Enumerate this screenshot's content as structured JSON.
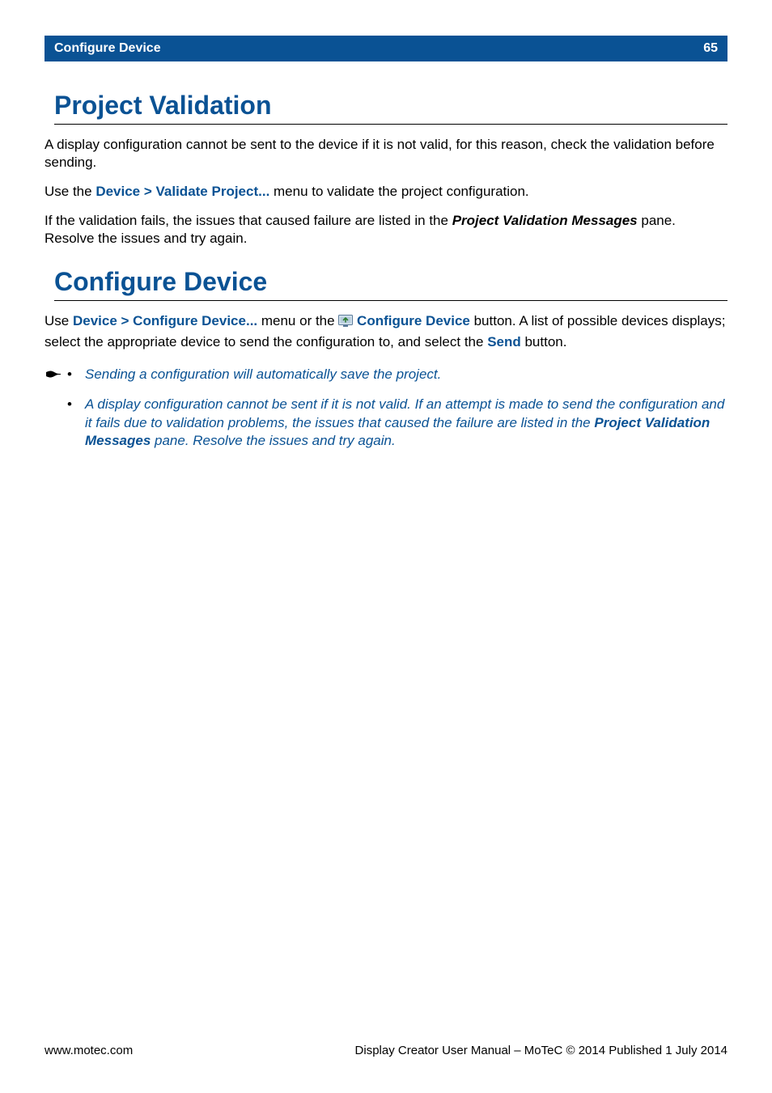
{
  "header": {
    "title": "Configure Device",
    "page_number": "65"
  },
  "sections": {
    "s1": {
      "title": "Project Validation",
      "p1": "A display configuration cannot be sent to the device if it is not valid, for this reason, check the validation before sending.",
      "p2a": "Use the ",
      "p2_link": "Device > Validate Project...",
      "p2b": " menu to validate the project configuration.",
      "p3a": "If the validation fails, the issues that caused failure are listed in the ",
      "p3_bi": "Project Validation Messages",
      "p3b": " pane. Resolve the issues and try again."
    },
    "s2": {
      "title": "Configure Device",
      "p1a": "Use ",
      "p1_link1": "Device > Configure Device...",
      "p1b": " menu or the ",
      "p1_link2": "Configure Device",
      "p1c": " button. A list of possible devices displays; select the appropriate device to send the configuration to, and select the ",
      "p1_link3": "Send",
      "p1d": " button.",
      "notes": {
        "n1": "Sending a configuration will automatically save the project.",
        "n2a": "A display configuration cannot be sent if it is not valid. If an attempt is made to send the configuration and it fails due to validation problems, the issues that caused the failure are listed in the ",
        "n2_bi": "Project Validation Messages",
        "n2b": " pane. Resolve the issues and try again."
      }
    }
  },
  "footer": {
    "left": "www.motec.com",
    "right": "Display Creator User Manual – MoTeC © 2014 Published 1 July 2014"
  }
}
